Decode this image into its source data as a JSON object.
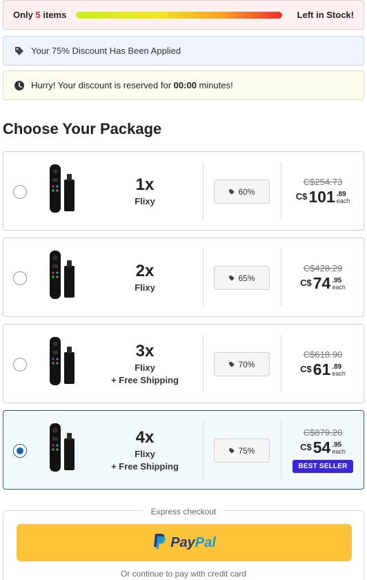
{
  "stock": {
    "prefix": "Only",
    "count": "5",
    "suffix": "items",
    "right": "Left in Stock!"
  },
  "discount": {
    "text": "Your 75% Discount Has Been Applied",
    "icon": "tag-icon"
  },
  "reserve": {
    "before": "Hurry! Your discount is reserved for",
    "time": "00:00",
    "after": "minutes!",
    "icon": "clock-icon"
  },
  "section_title": "Choose Your Package",
  "packages": [
    {
      "qty": "1x",
      "name": "Flixy",
      "shipping": "",
      "percent": "60%",
      "old_price": "C$254.73",
      "currency": "C$",
      "whole": "101",
      "cents": ".89",
      "each": "each",
      "badge": "",
      "selected": false
    },
    {
      "qty": "2x",
      "name": "Flixy",
      "shipping": "",
      "percent": "65%",
      "old_price": "C$428.29",
      "currency": "C$",
      "whole": "74",
      "cents": ".95",
      "each": "each",
      "badge": "",
      "selected": false
    },
    {
      "qty": "3x",
      "name": "Flixy",
      "shipping": "+ Free Shipping",
      "percent": "70%",
      "old_price": "C$618.90",
      "currency": "C$",
      "whole": "61",
      "cents": ".89",
      "each": "each",
      "badge": "",
      "selected": false
    },
    {
      "qty": "4x",
      "name": "Flixy",
      "shipping": "+ Free Shipping",
      "percent": "75%",
      "old_price": "C$879.20",
      "currency": "C$",
      "whole": "54",
      "cents": ".95",
      "each": "each",
      "badge": "BEST SELLER",
      "selected": true
    }
  ],
  "express": {
    "label": "Express checkout",
    "paypal_part1": "Pay",
    "paypal_part2": "Pal",
    "or_text": "Or continue to pay with credit card"
  },
  "colors": {
    "accent": "#3b27d8",
    "paypal_yellow": "#ffc43a",
    "radio_blue": "#1e5fb4",
    "stock_red": "#dd2222"
  }
}
